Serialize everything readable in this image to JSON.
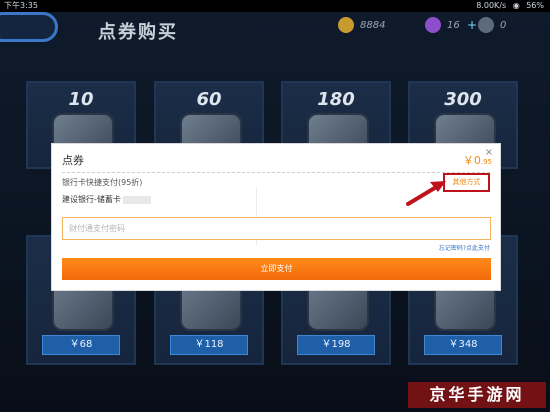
{
  "status_bar": {
    "time": "下午3:35",
    "net_speed": "8.00K/s",
    "battery": "56%"
  },
  "header": {
    "title": "点券购买",
    "resources": [
      {
        "icon": "gold-coin-icon",
        "value": "8884"
      },
      {
        "icon": "purple-gem-icon",
        "value": "16"
      },
      {
        "icon": "silver-icon",
        "value": "0"
      }
    ]
  },
  "cards_top": [
    {
      "amount": "10"
    },
    {
      "amount": "60"
    },
    {
      "amount": "180"
    },
    {
      "amount": "300"
    }
  ],
  "cards_bottom": [
    {
      "price": "￥68"
    },
    {
      "price": "￥118"
    },
    {
      "price": "￥198"
    },
    {
      "price": "￥348"
    }
  ],
  "dialog": {
    "title": "点券",
    "amount": "￥0",
    "amount_suffix": ".95",
    "method_label": "银行卡快捷支付(95折)",
    "other_method": "其他方式",
    "bank": "建设银行-储蓄卡",
    "password_placeholder": "财付通支付密码",
    "forgot_link": "忘记密码?点此支付",
    "pay_button": "立即支付"
  },
  "colors": {
    "accent_orange": "#f26a09",
    "highlight_red": "#c0121b",
    "price_blue": "#1f5fa8"
  },
  "watermark": "京华手游网"
}
